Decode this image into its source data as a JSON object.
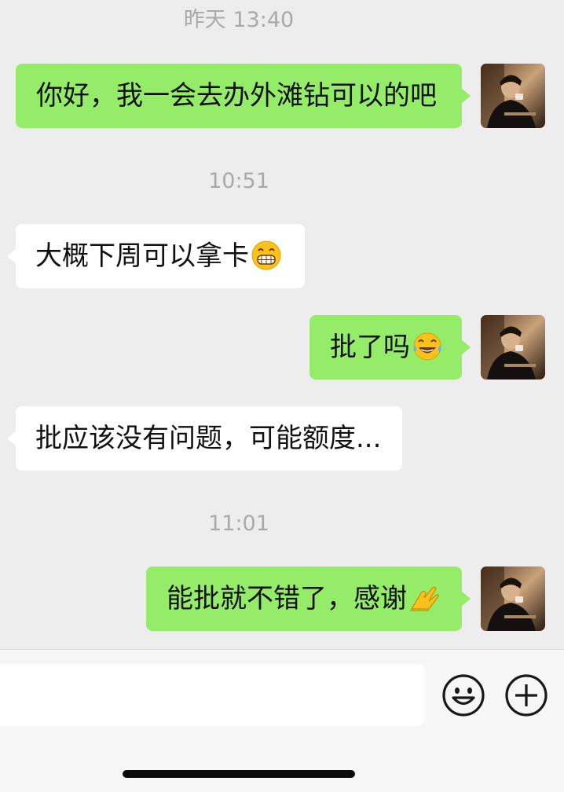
{
  "chat": {
    "timestamps": [
      "昨天 13:40",
      "10:51",
      "11:01"
    ],
    "messages": [
      {
        "side": "right",
        "text": "你好，我一会去办外滩钻可以的吧",
        "emoji": ""
      },
      {
        "side": "left",
        "text": "大概下周可以拿卡",
        "emoji": "grinning-face-icon"
      },
      {
        "side": "right",
        "text": "批了吗",
        "emoji": "tears-of-joy-icon"
      },
      {
        "side": "left",
        "text": "批应该没有问题，可能额度...",
        "emoji": ""
      },
      {
        "side": "right",
        "text": "能批就不错了，感谢",
        "emoji": "pinch-hand-icon"
      }
    ]
  },
  "input_bar": {
    "input_value": "",
    "icons": [
      "emoji-face-icon",
      "plus-circle-icon"
    ]
  },
  "colors": {
    "background": "#ededed",
    "sent_bubble": "#95ec69",
    "received_bubble": "#ffffff",
    "timestamp_text": "#a9a9a9"
  }
}
